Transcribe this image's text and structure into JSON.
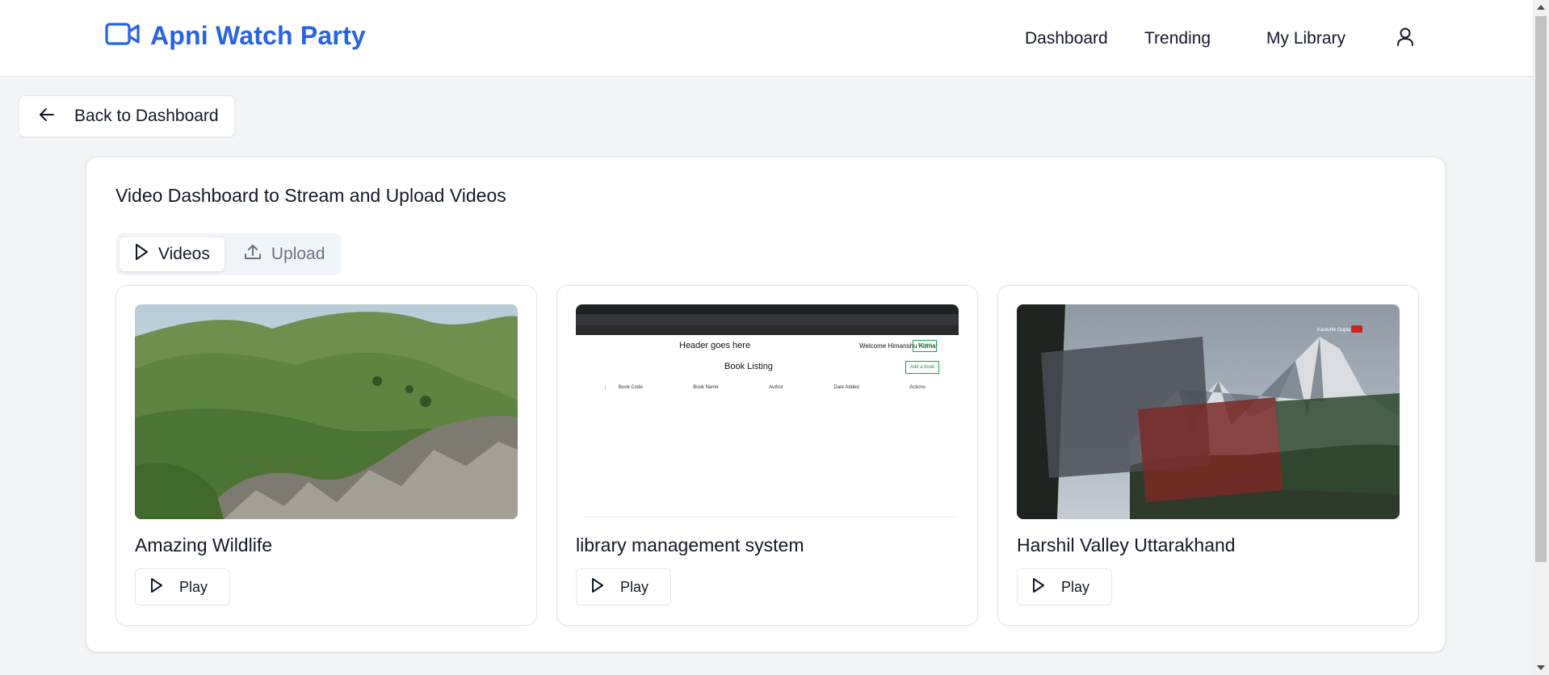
{
  "brand": {
    "name": "Apni Watch Party",
    "color": "#2563eb",
    "icon": "video-camera-icon"
  },
  "nav": {
    "dashboard": "Dashboard",
    "trending": "Trending",
    "library": "My Library",
    "user_icon": "user-icon"
  },
  "back": {
    "label": "Back to Dashboard",
    "icon": "arrow-left-icon"
  },
  "panel": {
    "title": "Video Dashboard to Stream and Upload Videos",
    "tabs": [
      {
        "label": "Videos",
        "icon": "play-icon",
        "active": true
      },
      {
        "label": "Upload",
        "icon": "upload-icon",
        "active": false
      }
    ]
  },
  "videos": [
    {
      "title": "Amazing Wildlife",
      "thumbnail": "green-mountain-landscape",
      "play_label": "Play"
    },
    {
      "title": "library management system",
      "thumbnail": "app-screenshot",
      "play_label": "Play",
      "thumb_text": {
        "header": "Header goes here",
        "welcome": "Welcome Himanshu Kumar",
        "logout": "logout",
        "listing": "Book Listing",
        "add": "Add a book",
        "columns": [
          "Book Code",
          "Book Name",
          "Author",
          "Date Added",
          "Actions"
        ]
      }
    },
    {
      "title": "Harshil Valley Uttarakhand",
      "thumbnail": "snowy-peaks-prayer-flags",
      "play_label": "Play",
      "channel_tag": "Kautuhik Gupta"
    }
  ]
}
